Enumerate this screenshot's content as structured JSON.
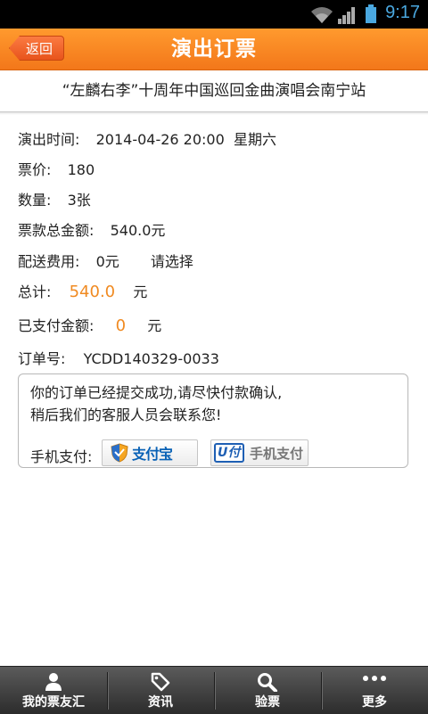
{
  "status_bar": {
    "time": "9:17"
  },
  "header": {
    "back_label": "返回",
    "title": "演出订票"
  },
  "event": {
    "title": "“左麟右李”十周年中国巡回金曲演唱会南宁站"
  },
  "details": {
    "show_time_label": "演出时间:",
    "show_time_value": "2014-04-26 20:00  星期六",
    "price_label": "票价:",
    "price_value": "180",
    "quantity_label": "数量:",
    "quantity_value": "3张",
    "ticket_total_label": "票款总金额:",
    "ticket_total_value": "540.0元",
    "delivery_label": "配送费用:",
    "delivery_value": "0元",
    "delivery_select": "请选择",
    "total_label": "总计:",
    "total_value": "540.0",
    "total_unit": "元",
    "paid_label": "已支付金额:",
    "paid_value": "0",
    "paid_unit": "元",
    "order_label": "订单号:",
    "order_value": "YCDD140329-0033"
  },
  "notice": {
    "line1": "你的订单已经提交成功,请尽快付款确认,",
    "line2": "稍后我们的客服人员会联系您!",
    "mobile_pay_label": "手机支付:",
    "alipay_label": "支付宝",
    "upay_logo": "U付",
    "upay_label": "手机支付"
  },
  "tabs": [
    {
      "label": "我的票友汇",
      "icon": "person-icon"
    },
    {
      "label": "资讯",
      "icon": "tag-icon"
    },
    {
      "label": "验票",
      "icon": "search-icon"
    },
    {
      "label": "更多",
      "icon": "more-dots-icon"
    }
  ],
  "colors": {
    "header_orange": "#f3771a",
    "accent_orange": "#f08a21",
    "status_blue": "#4aa8e0"
  }
}
